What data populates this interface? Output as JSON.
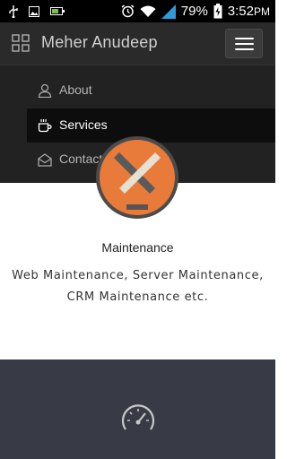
{
  "status_bar": {
    "battery_percent": "79%",
    "time": "3:52",
    "time_suffix": "PM",
    "icons": [
      "usb-icon",
      "image-icon",
      "battery-charging-small-icon",
      "alarm-icon",
      "wifi-icon",
      "signal-icon",
      "battery-icon"
    ]
  },
  "navbar": {
    "brand": "Meher Anudeep",
    "brand_icon": "grid-icon",
    "menu_icon": "hamburger-icon"
  },
  "menu": {
    "items": [
      {
        "label": "About",
        "icon": "user-icon",
        "active": false
      },
      {
        "label": "Services",
        "icon": "coffee-icon",
        "active": true
      },
      {
        "label": "Contact",
        "icon": "envelope-open-icon",
        "active": false
      }
    ]
  },
  "service": {
    "icon": "tools-icon",
    "title": "Maintenance",
    "description": "Web Maintenance, Server Maintenance, CRM Maintenance etc."
  },
  "next_service": {
    "icon": "speedometer-icon"
  },
  "colors": {
    "navbar_bg": "#2a2a2a",
    "active_item_bg": "#0d0d0d",
    "accent_orange": "#e87a3a",
    "dark_section_bg": "#383b45"
  }
}
